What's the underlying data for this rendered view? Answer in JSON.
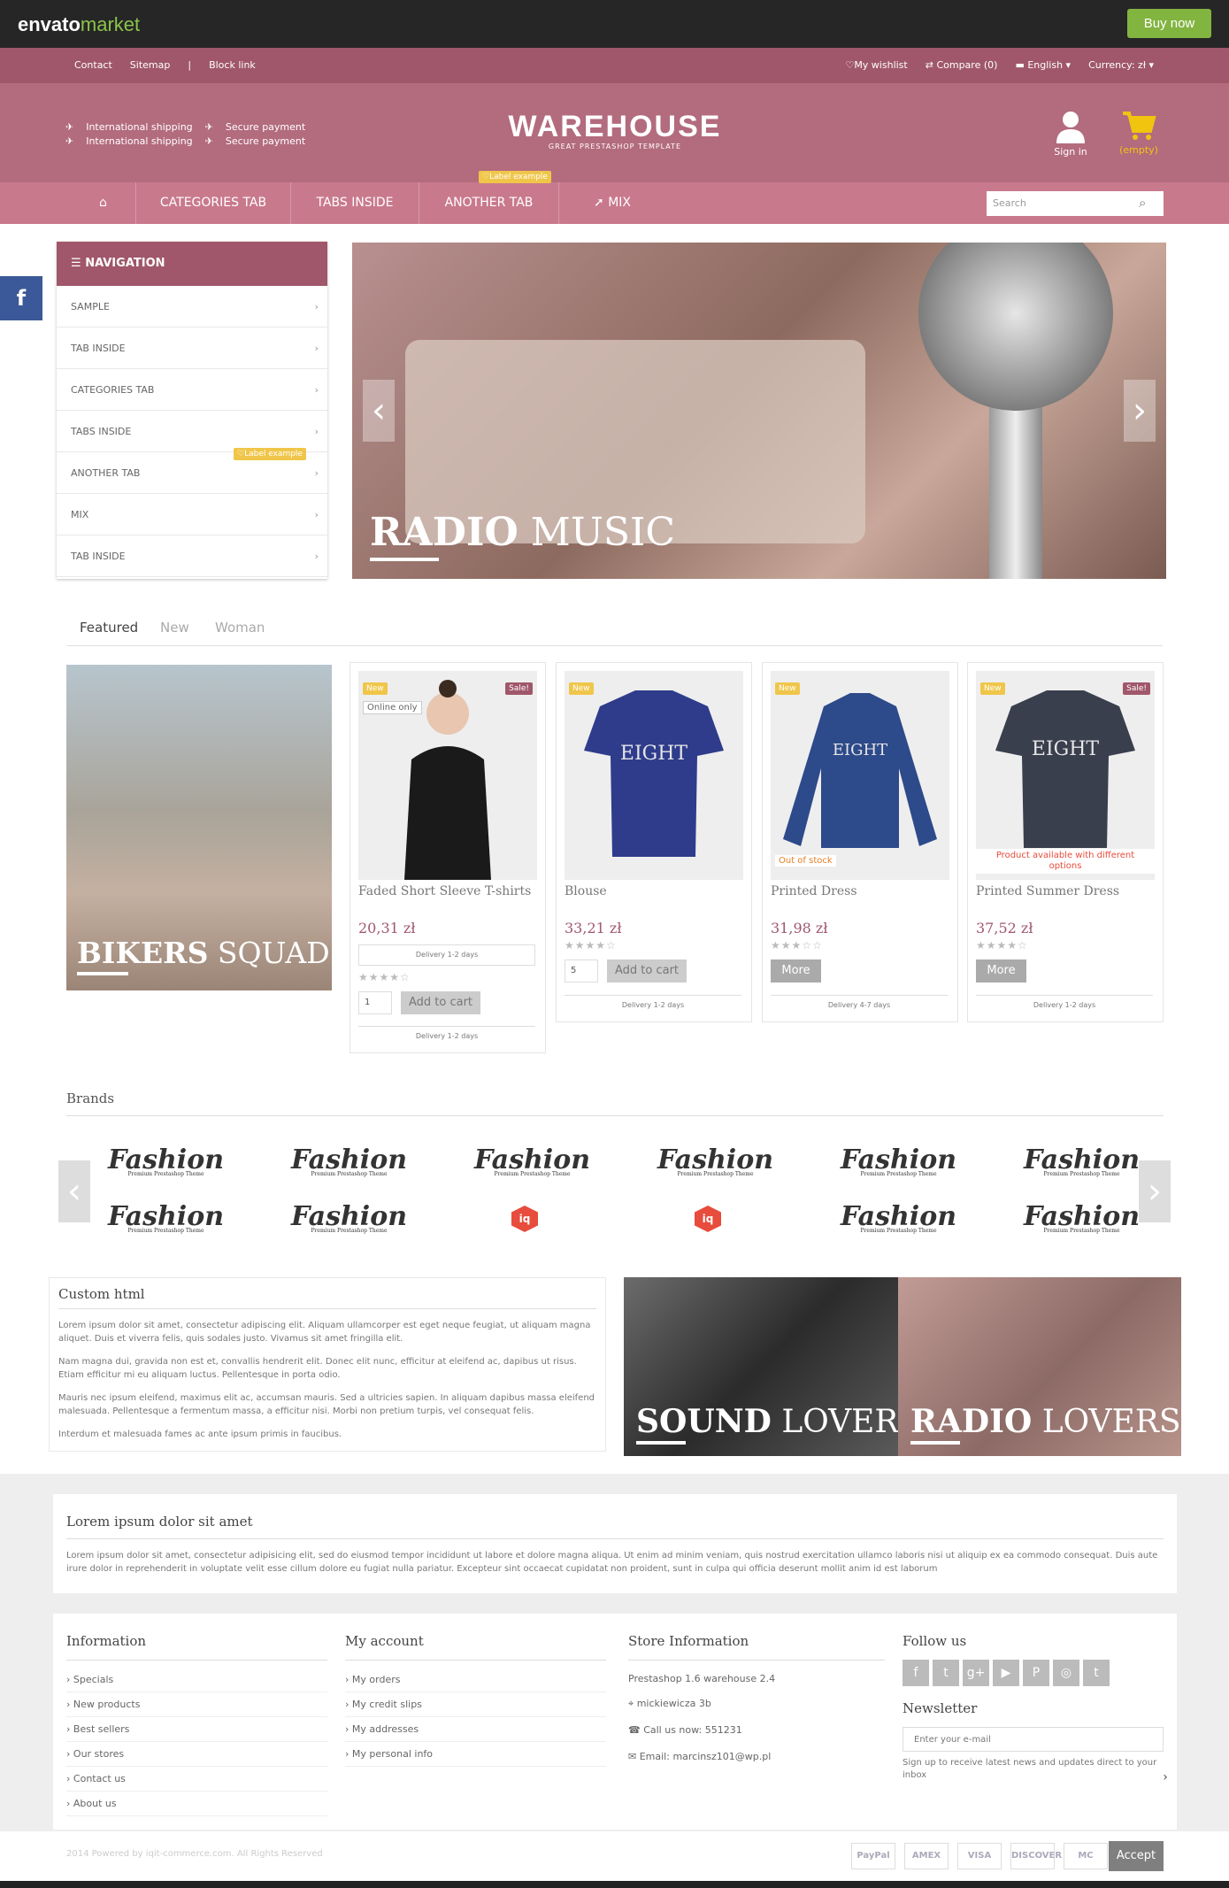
{
  "envato": {
    "logo_a": "envato",
    "logo_b": "market",
    "buy": "Buy now"
  },
  "topbar": {
    "left": [
      "Contact",
      "Sitemap",
      "|",
      "Block link"
    ],
    "wishlist": "My wishlist",
    "compare": "Compare (0)",
    "language": "English",
    "currency": "Currency: zł"
  },
  "header": {
    "features": [
      [
        "International shipping",
        "Secure payment"
      ],
      [
        "International shipping",
        "Secure payment"
      ]
    ],
    "title": "WAREHOUSE",
    "subtitle": "GREAT PRESTASHOP TEMPLATE",
    "signin": "Sign in",
    "cart": "(empty)"
  },
  "nav": {
    "items": [
      "CATEGORIES TAB",
      "TABS INSIDE",
      "ANOTHER TAB",
      "MIX"
    ],
    "label": "Label example",
    "search_placeholder": "Search"
  },
  "sidenav": {
    "title": "NAVIGATION",
    "items": [
      "SAMPLE",
      "TAB INSIDE",
      "CATEGORIES TAB",
      "TABS INSIDE",
      "ANOTHER TAB",
      "MIX",
      "TAB INSIDE"
    ],
    "label": "Label example"
  },
  "slider": {
    "caption_bold": "RADIO",
    "caption_rest": " MUSIC"
  },
  "tabs": [
    "Featured",
    "New",
    "Woman"
  ],
  "promo": {
    "bold": "BIKERS",
    "rest": " SQUAD"
  },
  "products": [
    {
      "name": "Faded Short Sleeve T-shirts",
      "price": "20,31 zł",
      "new": "New",
      "sale": "Sale!",
      "extra": "Online only",
      "delivery": "Delivery 1-2 days",
      "qty": "1",
      "button": "Add to cart",
      "footer": "Delivery 1-2 days",
      "rating": 4
    },
    {
      "name": "Blouse",
      "price": "33,21 zł",
      "new": "New",
      "qty": "5",
      "button": "Add to cart",
      "footer": "Delivery 1-2 days",
      "rating": 4
    },
    {
      "name": "Printed Dress",
      "price": "31,98 zł",
      "new": "New",
      "extra": "Out of stock",
      "button": "More",
      "footer": "Delivery 4-7 days",
      "rating": 3
    },
    {
      "name": "Printed Summer Dress",
      "price": "37,52 zł",
      "new": "New",
      "sale": "Sale!",
      "extra": "Product available with different options",
      "button": "More",
      "footer": "Delivery 1-2 days",
      "rating": 4
    }
  ],
  "brands": {
    "title": "Brands",
    "logo": "Fashion",
    "logo_sub": "Premium Prestashop Theme",
    "iq": "iq"
  },
  "custom": {
    "title": "Custom html",
    "p1": "Lorem ipsum dolor sit amet, consectetur adipiscing elit. Aliquam ullamcorper est eget neque feugiat, ut aliquam magna aliquet. Duis et viverra felis, quis sodales justo. Vivamus sit amet fringilla elit.",
    "p2": "Nam magna dui, gravida non est et, convallis hendrerit elit. Donec elit nunc, efficitur at eleifend ac, dapibus ut risus. Etiam efficitur mi eu aliquam luctus. Pellentesque in porta odio.",
    "p3": "Mauris nec ipsum eleifend, maximus elit ac, accumsan mauris. Sed a ultricies sapien. In aliquam dapibus massa eleifend malesuada. Pellentesque a fermentum massa, a efficitur nisi. Morbi non pretium turpis, vel consequat felis.",
    "p4": "Interdum et malesuada fames ac ante ipsum primis in faucibus."
  },
  "banners": {
    "sound_bold": "SOUND",
    "sound_rest": " LOVERS",
    "radio_bold": "RADIO",
    "radio_rest": " LOVERS"
  },
  "lorem": {
    "title": "Lorem ipsum dolor sit amet",
    "text": "Lorem ipsum dolor sit amet, consectetur adipisicing elit, sed do eiusmod tempor incididunt ut labore et dolore magna aliqua. Ut enim ad minim veniam, quis nostrud exercitation ullamco laboris nisi ut aliquip ex ea commodo consequat. Duis aute irure dolor in reprehenderit in voluptate velit esse cillum dolore eu fugiat nulla pariatur. Excepteur sint occaecat cupidatat non proident, sunt in culpa qui officia deserunt mollit anim id est laborum"
  },
  "footer": {
    "info_title": "Information",
    "info": [
      "Specials",
      "New products",
      "Best sellers",
      "Our stores",
      "Contact us",
      "About us"
    ],
    "account_title": "My account",
    "account": [
      "My orders",
      "My credit slips",
      "My addresses",
      "My personal info"
    ],
    "store_title": "Store Information",
    "store_name": "Prestashop 1.6 warehouse 2.4",
    "address": "mickiewicza 3b",
    "phone": "Call us now: 551231",
    "email": "Email: marcinsz101@wp.pl",
    "follow_title": "Follow us",
    "social": [
      "f",
      "t",
      "g+",
      "▶",
      "P",
      "◎",
      "t"
    ],
    "newsletter_title": "Newsletter",
    "newsletter_placeholder": "Enter your e-mail",
    "newsletter_note": "Sign up to receive latest news and updates direct to your inbox"
  },
  "bottom": {
    "copyright": "2014 Powered by iqit-commerce.com. All Rights Reserved",
    "payments": [
      "PayPal",
      "AMEX",
      "VISA",
      "DISCOVER",
      "MC"
    ],
    "accept": "Accept"
  }
}
